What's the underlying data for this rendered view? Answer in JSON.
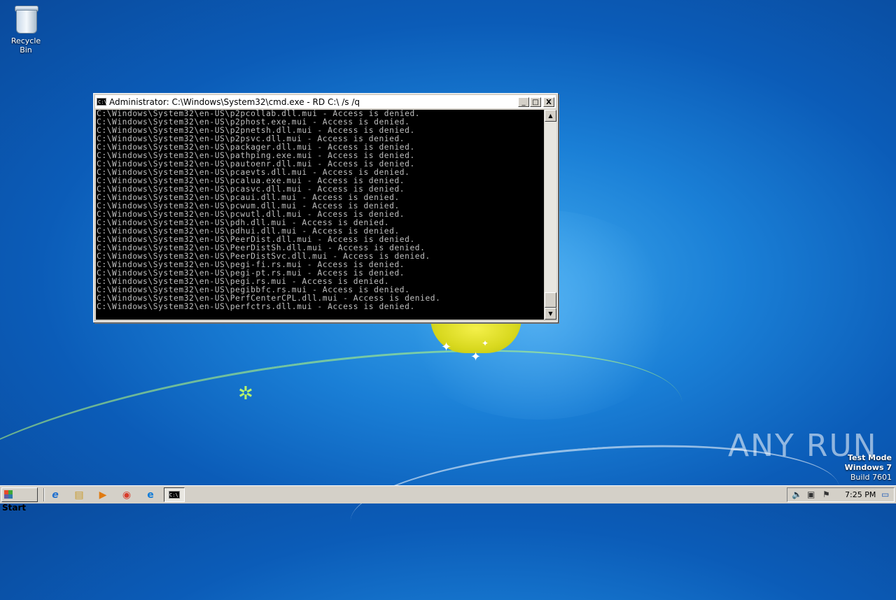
{
  "desktop": {
    "icons": [
      {
        "label": "Recycle Bin",
        "icon": "recycle-bin-icon"
      }
    ],
    "watermark": "ANY RUN",
    "test_mode": {
      "line1": "Test Mode",
      "line2": "Windows 7",
      "line3": "Build 7601"
    }
  },
  "window": {
    "title": "Administrator: C:\\Windows\\System32\\cmd.exe - RD  C:\\ /s /q",
    "controls": {
      "minimize": "_",
      "maximize": "□",
      "close": "X"
    },
    "console_lines": [
      "C:\\Windows\\System32\\en-US\\p2pcollab.dll.mui - Access is denied.",
      "C:\\Windows\\System32\\en-US\\p2phost.exe.mui - Access is denied.",
      "C:\\Windows\\System32\\en-US\\p2pnetsh.dll.mui - Access is denied.",
      "C:\\Windows\\System32\\en-US\\p2psvc.dll.mui - Access is denied.",
      "C:\\Windows\\System32\\en-US\\packager.dll.mui - Access is denied.",
      "C:\\Windows\\System32\\en-US\\pathping.exe.mui - Access is denied.",
      "C:\\Windows\\System32\\en-US\\pautoenr.dll.mui - Access is denied.",
      "C:\\Windows\\System32\\en-US\\pcaevts.dll.mui - Access is denied.",
      "C:\\Windows\\System32\\en-US\\pcalua.exe.mui - Access is denied.",
      "C:\\Windows\\System32\\en-US\\pcasvc.dll.mui - Access is denied.",
      "C:\\Windows\\System32\\en-US\\pcaui.dll.mui - Access is denied.",
      "C:\\Windows\\System32\\en-US\\pcwum.dll.mui - Access is denied.",
      "C:\\Windows\\System32\\en-US\\pcwutl.dll.mui - Access is denied.",
      "C:\\Windows\\System32\\en-US\\pdh.dll.mui - Access is denied.",
      "C:\\Windows\\System32\\en-US\\pdhui.dll.mui - Access is denied.",
      "C:\\Windows\\System32\\en-US\\PeerDist.dll.mui - Access is denied.",
      "C:\\Windows\\System32\\en-US\\PeerDistSh.dll.mui - Access is denied.",
      "C:\\Windows\\System32\\en-US\\PeerDistSvc.dll.mui - Access is denied.",
      "C:\\Windows\\System32\\en-US\\pegi-fi.rs.mui - Access is denied.",
      "C:\\Windows\\System32\\en-US\\pegi-pt.rs.mui - Access is denied.",
      "C:\\Windows\\System32\\en-US\\pegi.rs.mui - Access is denied.",
      "C:\\Windows\\System32\\en-US\\pegibbfc.rs.mui - Access is denied.",
      "C:\\Windows\\System32\\en-US\\PerfCenterCPL.dll.mui - Access is denied.",
      "C:\\Windows\\System32\\en-US\\perfctrs.dll.mui - Access is denied."
    ]
  },
  "taskbar": {
    "start_label": "Start",
    "pinned": [
      {
        "name": "internet-explorer-icon",
        "glyph": "e"
      },
      {
        "name": "file-explorer-icon",
        "glyph": "▤"
      },
      {
        "name": "media-player-icon",
        "glyph": "▶"
      },
      {
        "name": "chrome-icon",
        "glyph": "◉"
      },
      {
        "name": "edge-icon",
        "glyph": "e"
      }
    ],
    "active_task": "cmd-icon",
    "tray": {
      "clock": "7:25 PM",
      "icons": [
        "speaker-icon",
        "network-icon",
        "action-center-flag-icon",
        "show-desktop-icon"
      ]
    }
  }
}
